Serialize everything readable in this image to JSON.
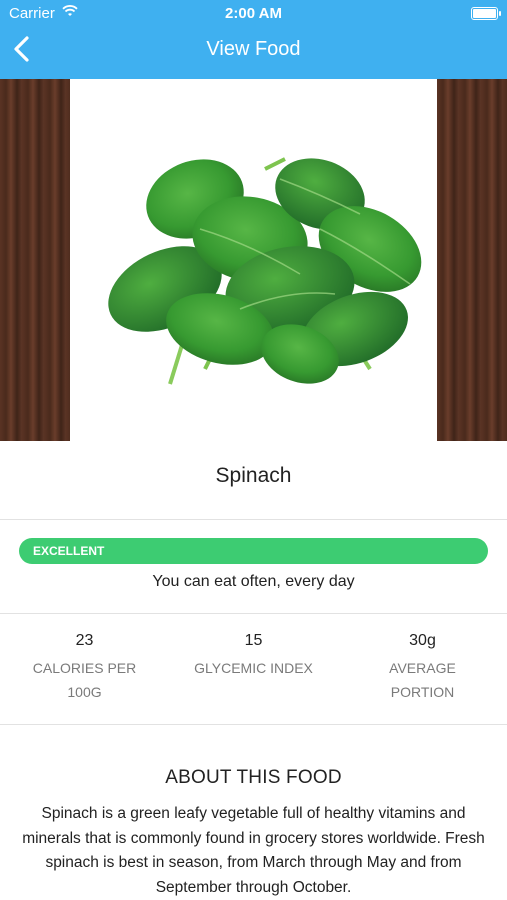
{
  "status_bar": {
    "carrier": "Carrier",
    "time": "2:00 AM"
  },
  "nav": {
    "title": "View Food",
    "back_icon": "chevron-left-icon"
  },
  "food": {
    "name": "Spinach",
    "image": "spinach-photo"
  },
  "rating": {
    "label": "EXCELLENT",
    "description": "You can eat often, every day",
    "color": "#3dcc72"
  },
  "stats": [
    {
      "value": "23",
      "label": "CALORIES PER 100G"
    },
    {
      "value": "15",
      "label": "GLYCEMIC INDEX"
    },
    {
      "value": "30g",
      "label": "AVERAGE PORTION"
    }
  ],
  "about": {
    "title": "ABOUT THIS FOOD",
    "text": "Spinach is a green leafy vegetable full of healthy vitamins and minerals that is commonly found in grocery stores worldwide. Fresh spinach is best in season, from March through May and from September through October."
  },
  "colors": {
    "header": "#3fb0f0",
    "accent": "#3dcc72"
  }
}
